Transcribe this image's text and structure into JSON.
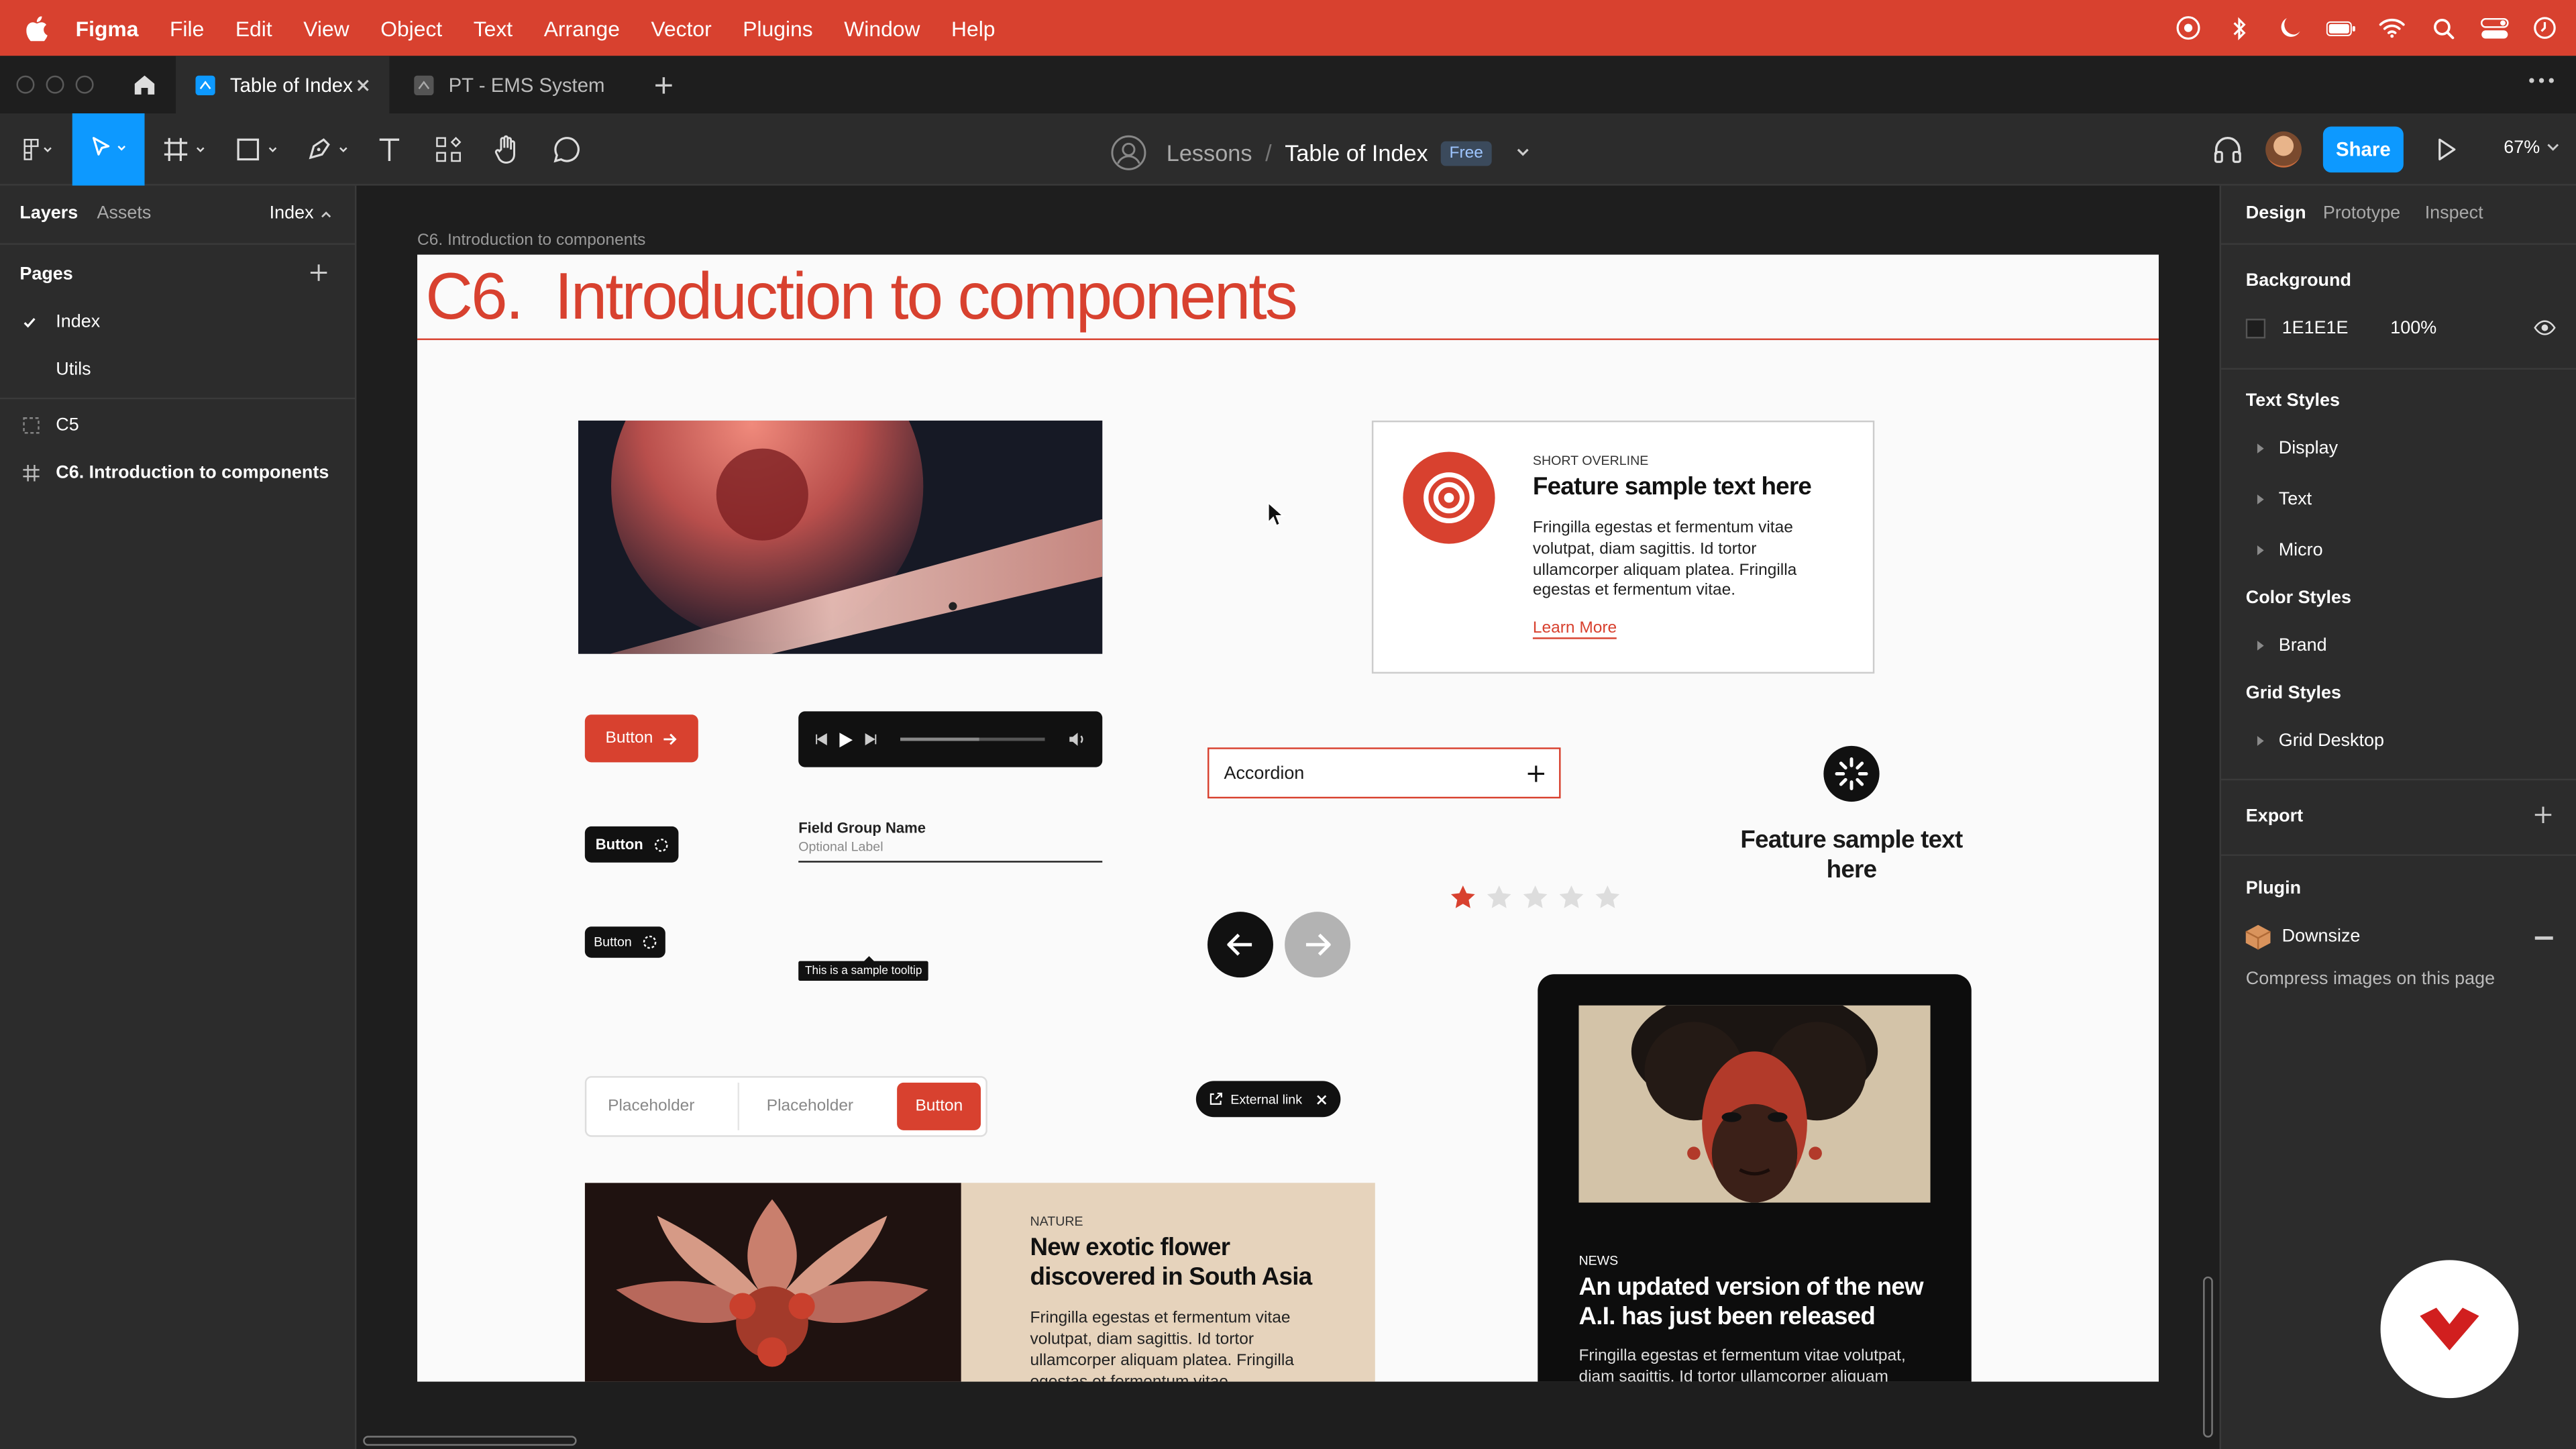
{
  "menubar": {
    "app_name": "Figma",
    "items": [
      "File",
      "Edit",
      "View",
      "Object",
      "Text",
      "Arrange",
      "Vector",
      "Plugins",
      "Window",
      "Help"
    ],
    "color": "#d8412f"
  },
  "tabs": [
    {
      "label": "Table of Index",
      "active": true
    },
    {
      "label": "PT - EMS System",
      "active": false
    }
  ],
  "toolbar": {
    "breadcrumb_project": "Lessons",
    "breadcrumb_separator": "/",
    "breadcrumb_file": "Table of Index",
    "plan_badge": "Free",
    "share_label": "Share",
    "zoom_label": "67%"
  },
  "left_panel": {
    "tab_layers": "Layers",
    "tab_assets": "Assets",
    "page_dropdown": "Index",
    "pages_title": "Pages",
    "pages": [
      {
        "label": "Index",
        "selected": true
      },
      {
        "label": "Utils",
        "selected": false
      }
    ],
    "layers": [
      {
        "label": "C5",
        "icon": "section-icon"
      },
      {
        "label": "C6. Introduction to components",
        "icon": "frame-icon"
      }
    ]
  },
  "canvas": {
    "frame_label": "C6. Introduction to components",
    "page_title": "C6.  Introduction to components",
    "button_label": "Button",
    "field_group_name": "Field Group Name",
    "field_optional_label": "Optional Label",
    "tooltip_text": "This is a sample tooltip",
    "accordion_label": "Accordion",
    "feature_overline": "SHORT OVERLINE",
    "feature_title": "Feature sample text here",
    "feature_body": "Fringilla egestas et fermentum vitae volutpat, diam sagittis. Id tortor ullamcorper aliquam platea. Fringilla egestas et fermentum vitae.",
    "feature_link": "Learn More",
    "feature_center_title": "Feature sample text here",
    "rating_filled": 1,
    "rating_total": 5,
    "search_placeholder_1": "Placeholder",
    "search_placeholder_2": "Placeholder",
    "search_button": "Button",
    "external_link_label": "External link",
    "card_nature_overline": "NATURE",
    "card_nature_title": "New exotic flower discovered in South Asia",
    "card_nature_body": "Fringilla egestas et fermentum vitae volutpat, diam sagittis. Id tortor ullamcorper aliquam platea. Fringilla egestas et fermentum vitae.",
    "card_news_overline": "NEWS",
    "card_news_title": "An updated version of the new A.I. has just been released",
    "card_news_body": "Fringilla egestas et fermentum vitae volutpat, diam sagittis. Id tortor ullamcorper aliquam",
    "accent_color": "#d8412f"
  },
  "right_panel": {
    "tab_design": "Design",
    "tab_prototype": "Prototype",
    "tab_inspect": "Inspect",
    "background_title": "Background",
    "background_hex": "1E1E1E",
    "background_opacity": "100%",
    "text_styles_title": "Text Styles",
    "text_styles": [
      "Display",
      "Text",
      "Micro"
    ],
    "color_styles_title": "Color Styles",
    "color_styles": [
      "Brand"
    ],
    "grid_styles_title": "Grid Styles",
    "grid_styles": [
      "Grid Desktop"
    ],
    "export_title": "Export",
    "plugin_title": "Plugin",
    "plugin_name": "Downsize",
    "plugin_desc": "Compress images on this page"
  }
}
